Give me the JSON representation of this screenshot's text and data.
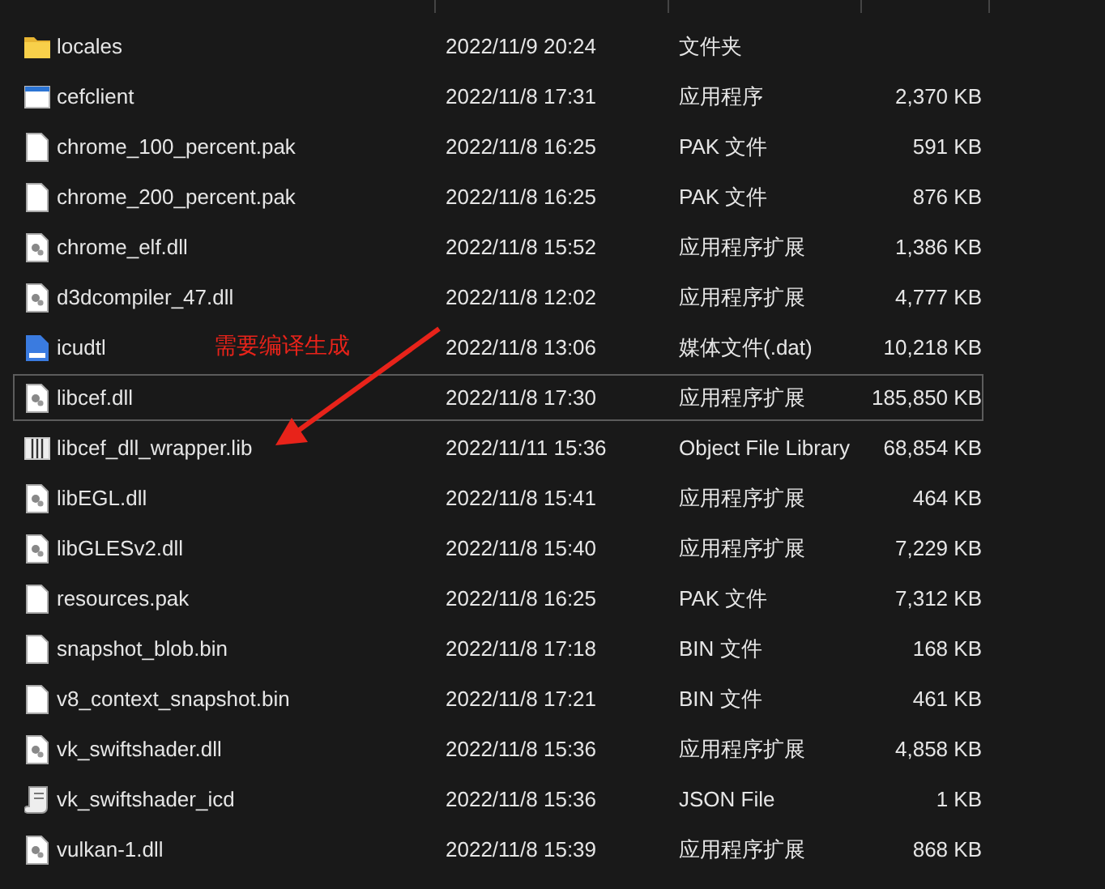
{
  "files": [
    {
      "name": "locales",
      "modified": "2022/11/9 20:24",
      "type": "文件夹",
      "kind": "folder",
      "focused": false
    },
    {
      "name": "cefclient",
      "modified": "2022/11/8 17:31",
      "type": "应用程序",
      "size": "2,370 KB",
      "kind": "app",
      "focused": false
    },
    {
      "name": "chrome_100_percent.pak",
      "modified": "2022/11/8 16:25",
      "type": "PAK 文件",
      "size": "591 KB",
      "kind": "file",
      "focused": false
    },
    {
      "name": "chrome_200_percent.pak",
      "modified": "2022/11/8 16:25",
      "type": "PAK 文件",
      "size": "876 KB",
      "kind": "file",
      "focused": false
    },
    {
      "name": "chrome_elf.dll",
      "modified": "2022/11/8 15:52",
      "type": "应用程序扩展",
      "size": "1,386 KB",
      "kind": "dll",
      "focused": false
    },
    {
      "name": "d3dcompiler_47.dll",
      "modified": "2022/11/8 12:02",
      "type": "应用程序扩展",
      "size": "4,777 KB",
      "kind": "dll",
      "focused": false
    },
    {
      "name": "icudtl",
      "modified": "2022/11/8 13:06",
      "type": "媒体文件(.dat)",
      "size": "10,218 KB",
      "kind": "media",
      "focused": false
    },
    {
      "name": "libcef.dll",
      "modified": "2022/11/8 17:30",
      "type": "应用程序扩展",
      "size": "185,850 KB",
      "kind": "dll",
      "focused": true
    },
    {
      "name": "libcef_dll_wrapper.lib",
      "modified": "2022/11/11 15:36",
      "type": "Object File Library",
      "size": "68,854 KB",
      "kind": "lib",
      "focused": false
    },
    {
      "name": "libEGL.dll",
      "modified": "2022/11/8 15:41",
      "type": "应用程序扩展",
      "size": "464 KB",
      "kind": "dll",
      "focused": false
    },
    {
      "name": "libGLESv2.dll",
      "modified": "2022/11/8 15:40",
      "type": "应用程序扩展",
      "size": "7,229 KB",
      "kind": "dll",
      "focused": false
    },
    {
      "name": "resources.pak",
      "modified": "2022/11/8 16:25",
      "type": "PAK 文件",
      "size": "7,312 KB",
      "kind": "file",
      "focused": false
    },
    {
      "name": "snapshot_blob.bin",
      "modified": "2022/11/8 17:18",
      "type": "BIN 文件",
      "size": "168 KB",
      "kind": "file",
      "focused": false
    },
    {
      "name": "v8_context_snapshot.bin",
      "modified": "2022/11/8 17:21",
      "type": "BIN 文件",
      "size": "461 KB",
      "kind": "file",
      "focused": false
    },
    {
      "name": "vk_swiftshader.dll",
      "modified": "2022/11/8 15:36",
      "type": "应用程序扩展",
      "size": "4,858 KB",
      "kind": "dll",
      "focused": false
    },
    {
      "name": "vk_swiftshader_icd",
      "modified": "2022/11/8 15:36",
      "type": "JSON File",
      "size": "1 KB",
      "kind": "json",
      "focused": false
    },
    {
      "name": "vulkan-1.dll",
      "modified": "2022/11/8 15:39",
      "type": "应用程序扩展",
      "size": "868 KB",
      "kind": "dll",
      "focused": false
    }
  ],
  "annotation": {
    "text": "需要编译生成"
  }
}
